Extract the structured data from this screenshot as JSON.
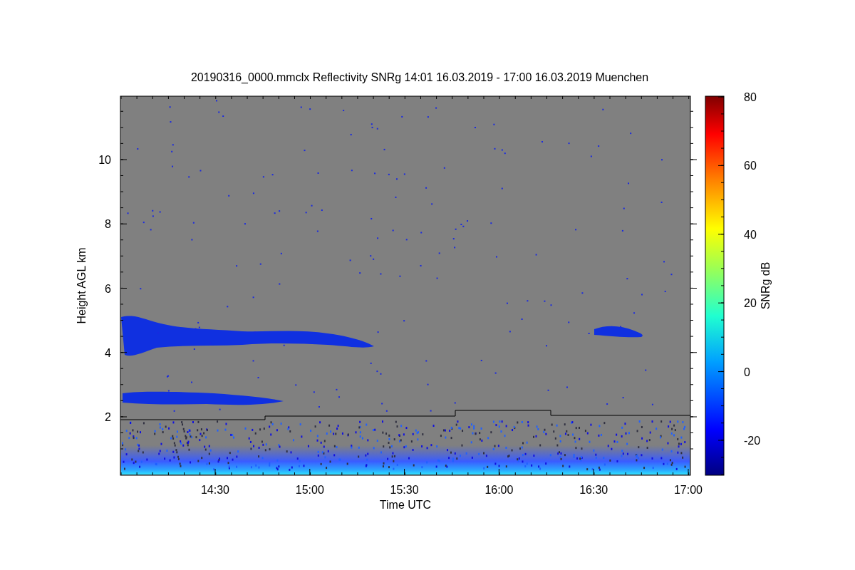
{
  "title": "20190316_0000.mmclx Reflectivity SNRg   14:01 16.03.2019 - 17:00 16.03.2019 Muenchen",
  "plot": {
    "ylabel": "Height AGL km",
    "xlabel": "Time UTC",
    "yticks": [
      "10",
      "8",
      "6",
      "4",
      "2"
    ],
    "xticks": [
      "14:30",
      "15:00",
      "15:30",
      "16:00",
      "16:30",
      "17:00"
    ]
  },
  "colorbar": {
    "label": "SNRg dB",
    "ticks": [
      "80",
      "60",
      "40",
      "20",
      "0",
      "-20"
    ]
  }
}
